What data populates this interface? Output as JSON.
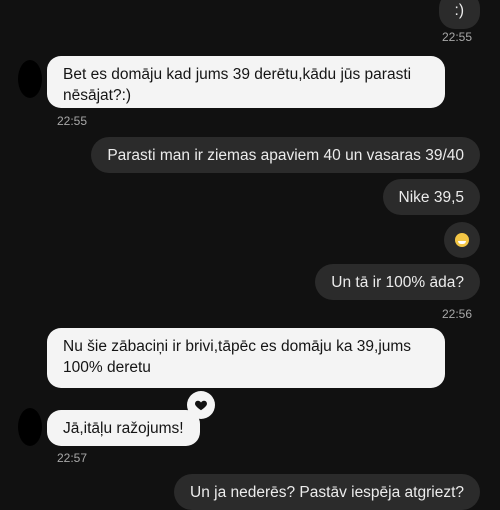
{
  "chat": {
    "messages": [
      {
        "id": "m1",
        "text": ":)"
      },
      {
        "id": "m2",
        "text": "Bet es domāju kad jums 39 derētu,kādu jūs parasti nēsājat?:)"
      },
      {
        "id": "m3",
        "text": "Parasti man ir ziemas apaviem 40 un vasaras 39/40"
      },
      {
        "id": "m4",
        "text": "Nike 39,5"
      },
      {
        "id": "m5",
        "emoji": "grinning-face"
      },
      {
        "id": "m6",
        "text": "Un tā ir 100% āda?"
      },
      {
        "id": "m7",
        "text": "Nu šie zābaciņi ir brivi,tāpēc es domāju ka 39,jums 100% deretu"
      },
      {
        "id": "m8",
        "text": "Jā,itāļu ražojums!",
        "reaction": "black-heart"
      },
      {
        "id": "m9",
        "text": "Un ja nederēs? Pastāv iespēja atgriezt?"
      }
    ],
    "timestamps": {
      "t1": "22:55",
      "t2": "22:55",
      "t3": "22:56",
      "t4": "22:57"
    }
  }
}
